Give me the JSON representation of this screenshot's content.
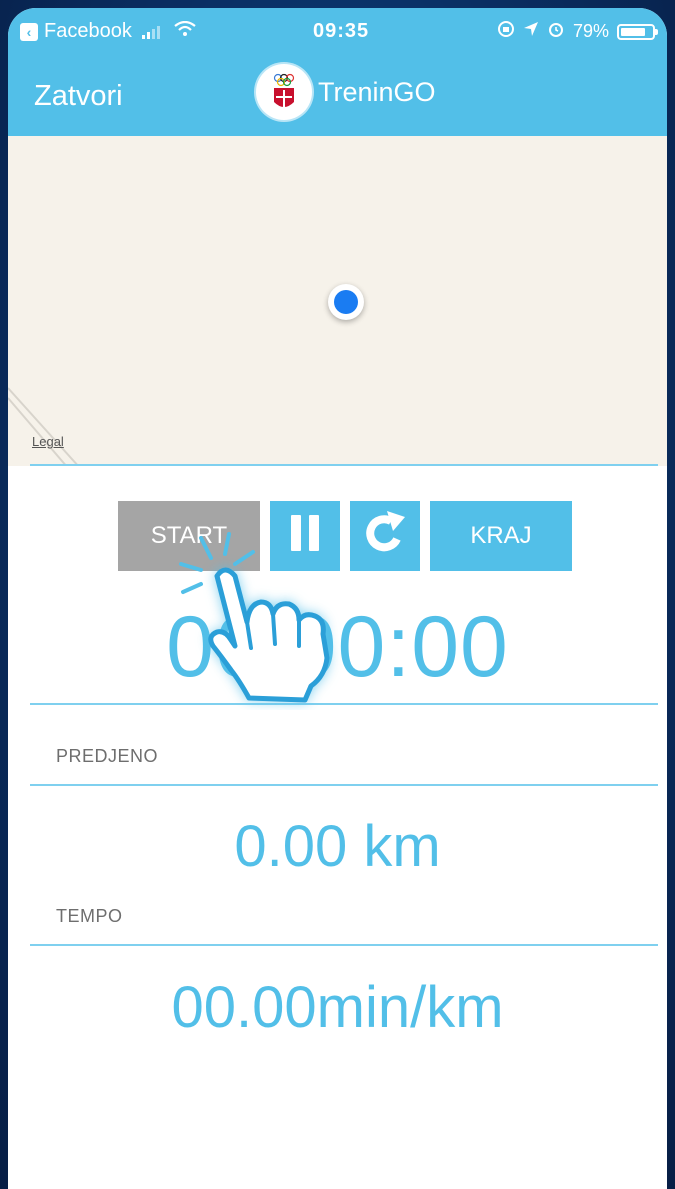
{
  "status_bar": {
    "back_app": "Facebook",
    "time": "09:35",
    "battery": "79%",
    "battery_level": 0.79
  },
  "nav": {
    "close_label": "Zatvori",
    "title": "TreninGO"
  },
  "map": {
    "legal_label": "Legal"
  },
  "controls": {
    "start_label": "START",
    "end_label": "KRAJ"
  },
  "timer": {
    "value": "00:00:00"
  },
  "distance": {
    "label": "PREDJENO",
    "value": "0.00 km"
  },
  "pace": {
    "label": "TEMPO",
    "value": "00.00",
    "unit": "min/km"
  },
  "colors": {
    "accent": "#52bfe8",
    "start_button": "#a5a5a5",
    "location_dot": "#1a7cf2"
  }
}
